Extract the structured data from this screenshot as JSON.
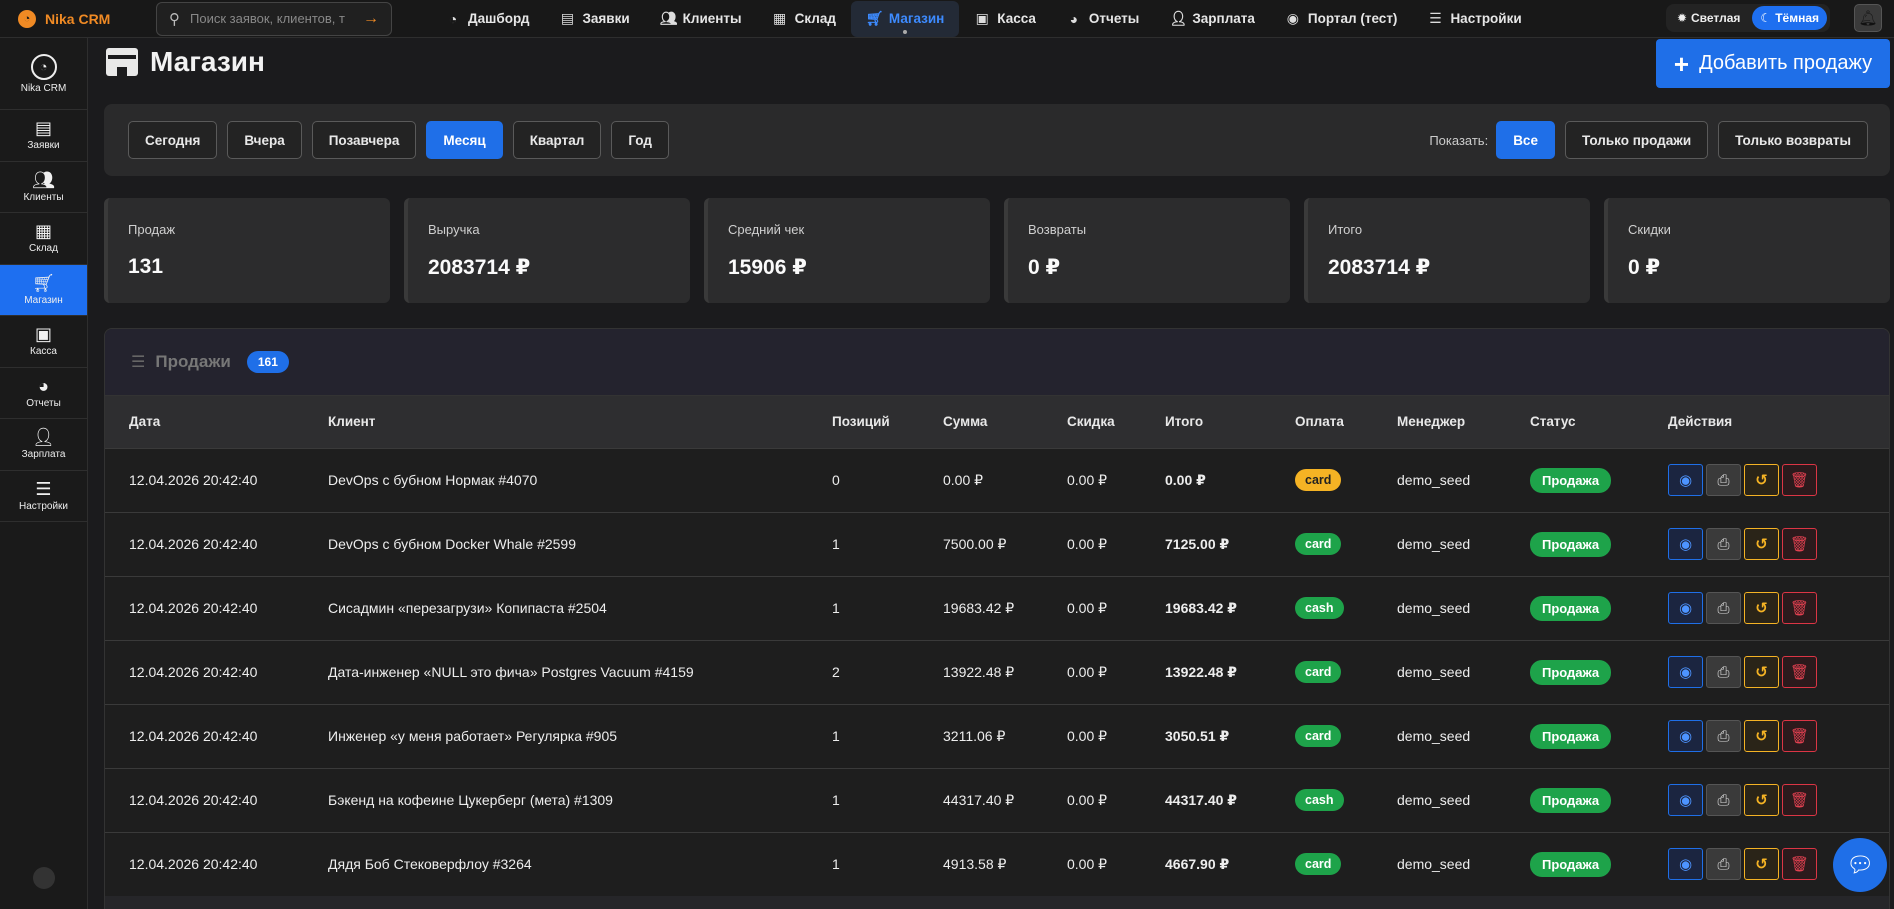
{
  "app": {
    "brand": "Nika CRM"
  },
  "search": {
    "placeholder": "Поиск заявок, клиентов, т"
  },
  "nav": [
    {
      "label": "Дашборд",
      "icon": "gauge-icon"
    },
    {
      "label": "Заявки",
      "icon": "document-icon"
    },
    {
      "label": "Клиенты",
      "icon": "users-icon"
    },
    {
      "label": "Склад",
      "icon": "boxes-icon"
    },
    {
      "label": "Магазин",
      "icon": "cart-icon",
      "active": true
    },
    {
      "label": "Касса",
      "icon": "cash-register-icon"
    },
    {
      "label": "Отчеты",
      "icon": "pie-chart-icon"
    },
    {
      "label": "Зарплата",
      "icon": "user-icon"
    },
    {
      "label": "Портал (тест)",
      "icon": "user-circle-icon"
    },
    {
      "label": "Настройки",
      "icon": "sliders-icon"
    }
  ],
  "theme": {
    "light": "Светлая",
    "dark": "Тёмная",
    "active": "dark"
  },
  "sidebar": [
    {
      "label": "Nika CRM",
      "icon": "gauge-icon"
    },
    {
      "label": "Заявки",
      "icon": "document-icon"
    },
    {
      "label": "Клиенты",
      "icon": "users-icon"
    },
    {
      "label": "Склад",
      "icon": "boxes-icon"
    },
    {
      "label": "Магазин",
      "icon": "cart-icon",
      "active": true
    },
    {
      "label": "Касса",
      "icon": "cash-register-icon"
    },
    {
      "label": "Отчеты",
      "icon": "pie-chart-icon"
    },
    {
      "label": "Зарплата",
      "icon": "user-icon"
    },
    {
      "label": "Настройки",
      "icon": "sliders-icon"
    }
  ],
  "page": {
    "title": "Магазин",
    "add_button": "Добавить продажу"
  },
  "filters": {
    "periods": [
      "Сегодня",
      "Вчера",
      "Позавчера",
      "Месяц",
      "Квартал",
      "Год"
    ],
    "active_period": "Месяц",
    "show_label": "Показать:",
    "show_options": [
      "Все",
      "Только продажи",
      "Только возвраты"
    ],
    "active_show": "Все"
  },
  "stats": [
    {
      "title": "Продаж",
      "value": "131"
    },
    {
      "title": "Выручка",
      "value": "2083714 ₽"
    },
    {
      "title": "Средний чек",
      "value": "15906 ₽"
    },
    {
      "title": "Возвраты",
      "value": "0 ₽"
    },
    {
      "title": "Итого",
      "value": "2083714 ₽"
    },
    {
      "title": "Скидки",
      "value": "0 ₽"
    }
  ],
  "sales": {
    "title": "Продажи",
    "count": "161",
    "columns": [
      "Дата",
      "Клиент",
      "Позиций",
      "Сумма",
      "Скидка",
      "Итого",
      "Оплата",
      "Менеджер",
      "Статус",
      "Действия"
    ],
    "rows": [
      {
        "date": "12.04.2026 20:42:40",
        "client": "DevOps с бубном Нормак #4070",
        "positions": "0",
        "sum": "0.00 ₽",
        "discount": "0.00 ₽",
        "total": "0.00 ₽",
        "payment": "card",
        "payment_color": "#f5b324",
        "manager": "demo_seed",
        "status": "Продажа"
      },
      {
        "date": "12.04.2026 20:42:40",
        "client": "DevOps с бубном Docker Whale #2599",
        "positions": "1",
        "sum": "7500.00 ₽",
        "discount": "0.00 ₽",
        "total": "7125.00 ₽",
        "payment": "card",
        "payment_color": "#1ea34a",
        "manager": "demo_seed",
        "status": "Продажа"
      },
      {
        "date": "12.04.2026 20:42:40",
        "client": "Сисадмин «перезагрузи» Копипаста #2504",
        "positions": "1",
        "sum": "19683.42 ₽",
        "discount": "0.00 ₽",
        "total": "19683.42 ₽",
        "payment": "cash",
        "payment_color": "#1ea34a",
        "manager": "demo_seed",
        "status": "Продажа"
      },
      {
        "date": "12.04.2026 20:42:40",
        "client": "Дата-инженер «NULL это фича» Postgres Vacuum #4159",
        "positions": "2",
        "sum": "13922.48 ₽",
        "discount": "0.00 ₽",
        "total": "13922.48 ₽",
        "payment": "card",
        "payment_color": "#1ea34a",
        "manager": "demo_seed",
        "status": "Продажа"
      },
      {
        "date": "12.04.2026 20:42:40",
        "client": "Инженер «у меня работает» Регулярка #905",
        "positions": "1",
        "sum": "3211.06 ₽",
        "discount": "0.00 ₽",
        "total": "3050.51 ₽",
        "payment": "card",
        "payment_color": "#1ea34a",
        "manager": "demo_seed",
        "status": "Продажа"
      },
      {
        "date": "12.04.2026 20:42:40",
        "client": "Бэкенд на кофеине Цукерберг (мета) #1309",
        "positions": "1",
        "sum": "44317.40 ₽",
        "discount": "0.00 ₽",
        "total": "44317.40 ₽",
        "payment": "cash",
        "payment_color": "#1ea34a",
        "manager": "demo_seed",
        "status": "Продажа"
      },
      {
        "date": "12.04.2026 20:42:40",
        "client": "Дядя Боб Стековерфлоу #3264",
        "positions": "1",
        "sum": "4913.58 ₽",
        "discount": "0.00 ₽",
        "total": "4667.90 ₽",
        "payment": "card",
        "payment_color": "#1ea34a",
        "manager": "demo_seed",
        "status": "Продажа"
      }
    ]
  },
  "colors": {
    "accent": "#1f6fe8",
    "brand": "#f08a24",
    "success": "#1ea34a",
    "warning": "#f5b324",
    "danger": "#dc3545"
  }
}
